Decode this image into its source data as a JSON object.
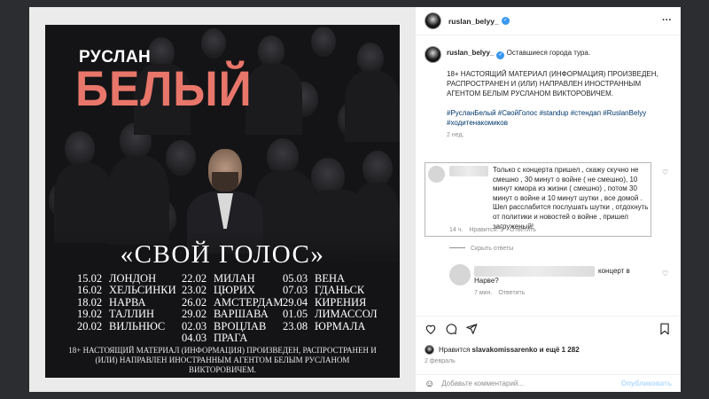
{
  "poster": {
    "first_name": "РУСЛАН",
    "last_name": "БЕЛЫЙ",
    "show_title": "«СВОЙ ГОЛОС»",
    "dates_col1": [
      {
        "date": "15.02",
        "city": "ЛОНДОН"
      },
      {
        "date": "16.02",
        "city": "ХЕЛЬСИНКИ"
      },
      {
        "date": "18.02",
        "city": "НАРВА"
      },
      {
        "date": "19.02",
        "city": "ТАЛЛИН"
      },
      {
        "date": "20.02",
        "city": "ВИЛЬНЮС"
      }
    ],
    "dates_col2": [
      {
        "date": "22.02",
        "city": "МИЛАН"
      },
      {
        "date": "23.02",
        "city": "ЦЮРИХ"
      },
      {
        "date": "26.02",
        "city": "АМСТЕРДАМ"
      },
      {
        "date": "29.02",
        "city": "ВАРШАВА"
      },
      {
        "date": "02.03",
        "city": "ВРОЦЛАВ"
      },
      {
        "date": "04.03",
        "city": "ПРАГА"
      }
    ],
    "dates_col3": [
      {
        "date": "05.03",
        "city": "ВЕНА"
      },
      {
        "date": "07.03",
        "city": "ГДАНЬСК"
      },
      {
        "date": "29.04",
        "city": "КИРЕНИЯ"
      },
      {
        "date": "01.05",
        "city": "ЛИМАССОЛ"
      },
      {
        "date": "23.08",
        "city": "ЮРМАЛА"
      }
    ],
    "disclaimer": "18+ НАСТОЯЩИЙ МАТЕРИАЛ (ИНФОРМАЦИЯ) ПРОИЗВЕДЕН, РАСПРОСТРАНЕН И (ИЛИ) НАПРАВЛЕН ИНОСТРАННЫМ АГЕНТОМ БЕЛЫМ РУСЛАНОМ ВИКТОРОВИЧЕМ."
  },
  "header": {
    "username": "ruslan_belyy_",
    "more": "···"
  },
  "caption": {
    "username": "ruslan_belyy_",
    "intro": "Оставшиеся города тура.",
    "notice": "18+ НАСТОЯЩИЙ МАТЕРИАЛ (ИНФОРМАЦИЯ) ПРОИЗВЕДЕН, РАСПРОСТРАНЕН И (ИЛИ) НАПРАВЛЕН ИНОСТРАННЫМ АГЕНТОМ БЕЛЫМ РУСЛАНОМ ВИКТОРОВИЧЕМ.",
    "hashtags": "#РусланБелый #СвойГолос #standup #стендап #RuslanBelyy #ходитенакомиков",
    "time": "2 нед."
  },
  "comment": {
    "text": "Только с концерта пришел , скажу скучно не смешно , 30 минут о войне ( не смешно), 10 минут юмора из жизни ( смешно) , потом 30 минут о войне и 10 минут шутки , все домой . Шел расслабится послушать шутки , отдохнуть от политики и новостей о войне , пришел загруженый!",
    "time": "14 ч.",
    "likes": "Нравится: 1",
    "reply": "Ответить",
    "hide_replies": "Скрыть ответы"
  },
  "reply": {
    "text_tail": "концерт в",
    "text_line2": "Нарве?",
    "time": "7 мин.",
    "reply": "Ответить"
  },
  "likes": {
    "prefix": "Нравится",
    "user": "slavakomissarenko",
    "suffix": "и ещё 1 282",
    "date": "2 февраль"
  },
  "add_comment": {
    "placeholder": "Добавьте комментарий...",
    "publish": "Опубликовать"
  },
  "colors": {
    "accent": "#e8766a",
    "link": "#00376b",
    "publish": "#b3dbff"
  }
}
